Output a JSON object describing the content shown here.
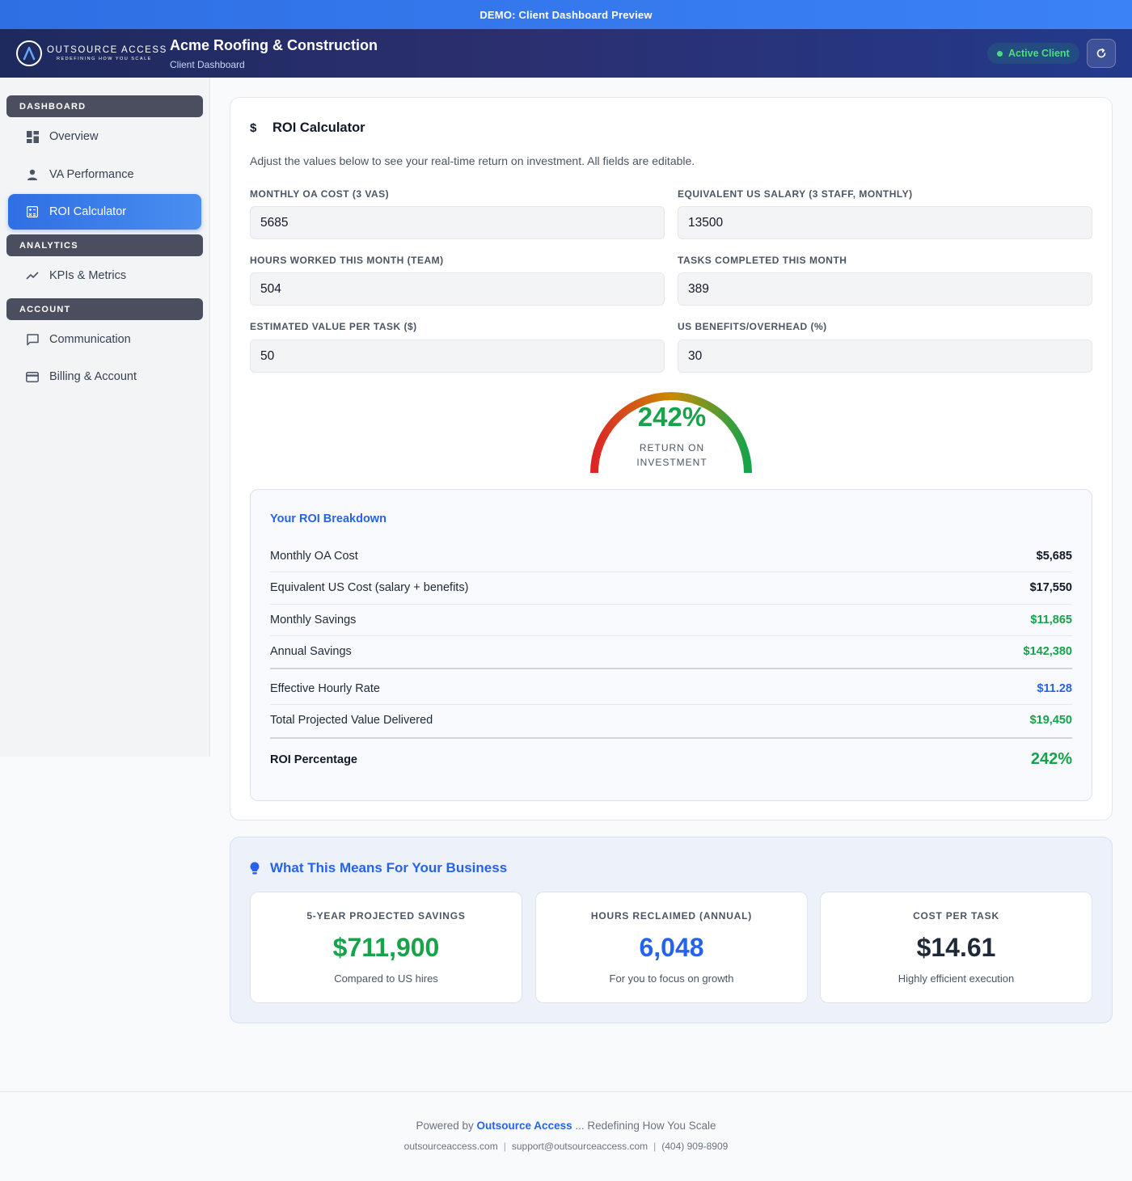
{
  "demo_banner": "DEMO: Client Dashboard Preview",
  "header": {
    "logo_main": "OUTSOURCE ACCESS",
    "logo_sub": "REDEFINING HOW YOU SCALE",
    "client_name": "Acme Roofing & Construction",
    "client_subtitle": "Client Dashboard",
    "status_badge": "Active Client"
  },
  "sidebar": {
    "sections": [
      {
        "title": "DASHBOARD",
        "items": [
          {
            "label": "Overview",
            "icon": "grid-icon"
          },
          {
            "label": "VA Performance",
            "icon": "person-icon"
          },
          {
            "label": "ROI Calculator",
            "icon": "calculator-icon",
            "active": true
          }
        ]
      },
      {
        "title": "ANALYTICS",
        "items": [
          {
            "label": "KPIs & Metrics",
            "icon": "trend-icon"
          }
        ]
      },
      {
        "title": "ACCOUNT",
        "items": [
          {
            "label": "Communication",
            "icon": "chat-icon"
          },
          {
            "label": "Billing & Account",
            "icon": "card-icon"
          }
        ]
      }
    ]
  },
  "roi": {
    "title": "ROI Calculator",
    "description": "Adjust the values below to see your real-time return on investment. All fields are editable.",
    "fields": [
      {
        "label": "MONTHLY OA COST (3 VAS)",
        "value": "5685"
      },
      {
        "label": "EQUIVALENT US SALARY (3 STAFF, MONTHLY)",
        "value": "13500"
      },
      {
        "label": "HOURS WORKED THIS MONTH (TEAM)",
        "value": "504"
      },
      {
        "label": "TASKS COMPLETED THIS MONTH",
        "value": "389"
      },
      {
        "label": "ESTIMATED VALUE PER TASK ($)",
        "value": "50"
      },
      {
        "label": "US BENEFITS/OVERHEAD (%)",
        "value": "30"
      }
    ],
    "gauge": {
      "value": "242%",
      "label_line1": "RETURN ON",
      "label_line2": "INVESTMENT"
    },
    "breakdown": {
      "title": "Your ROI Breakdown",
      "rows": [
        {
          "label": "Monthly OA Cost",
          "value": "$5,685"
        },
        {
          "label": "Equivalent US Cost (salary + benefits)",
          "value": "$17,550"
        },
        {
          "label": "Monthly Savings",
          "value": "$11,865"
        },
        {
          "label": "Annual Savings",
          "value": "$142,380"
        },
        {
          "label": "Effective Hourly Rate",
          "value": "$11.28"
        },
        {
          "label": "Total Projected Value Delivered",
          "value": "$19,450"
        }
      ],
      "total_label": "ROI Percentage",
      "total_value": "242%"
    }
  },
  "means": {
    "title": "What This Means For Your Business",
    "stats": [
      {
        "label": "5-YEAR PROJECTED SAVINGS",
        "value": "$711,900",
        "sub": "Compared to US hires",
        "color": "#16a34a"
      },
      {
        "label": "HOURS RECLAIMED (ANNUAL)",
        "value": "6,048",
        "sub": "For you to focus on growth",
        "color": "#2563eb"
      },
      {
        "label": "COST PER TASK",
        "value": "$14.61",
        "sub": "Highly efficient execution",
        "color": "#1f2937"
      }
    ]
  },
  "footer": {
    "powered_prefix": "Powered by",
    "brand": "Outsource Access",
    "tagline": "... Redefining How You Scale",
    "website": "outsourceaccess.com",
    "email": "support@outsourceaccess.com",
    "phone": "(404) 909-8909"
  }
}
